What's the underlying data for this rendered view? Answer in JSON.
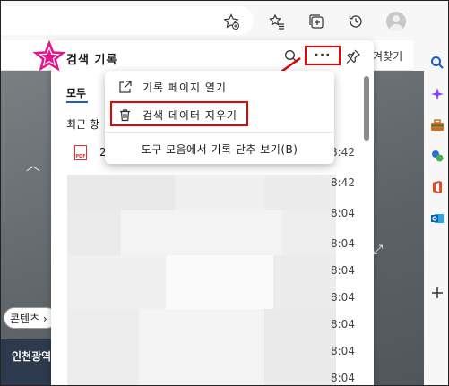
{
  "panel": {
    "title": "검색 기록",
    "tab_all": "모두",
    "section_recent": "최근 항",
    "more_label": "···"
  },
  "menu": {
    "open_history_page": "기록 페이지 열기",
    "clear_browsing_data": "검색 데이터 지우기",
    "show_history_toolbar": "도구 모음에서 기록 단추 보기(B)"
  },
  "favorites_bar": {
    "label": "즐겨찾기"
  },
  "page": {
    "content_pill": "콘텐츠 ›",
    "news_label": "인천광역"
  },
  "history": {
    "first_item_prefix": "2",
    "times": [
      "8:42",
      "8:42",
      "8:04",
      "8:04",
      "8:04",
      "8:04",
      "8:04",
      "8:04",
      "8:04",
      "8:04"
    ]
  },
  "colors": {
    "highlight_red": "#e00000",
    "accent_blue": "#1a5fb4"
  },
  "icons": {
    "toolbar": [
      "star-add-icon",
      "favorites-icon",
      "collections-icon",
      "history-icon",
      "profile-icon"
    ],
    "sidebar": [
      "search-icon",
      "sparkle-icon",
      "toolbox-icon",
      "games-icon",
      "office-icon",
      "outlook-icon",
      "plus-icon"
    ]
  }
}
